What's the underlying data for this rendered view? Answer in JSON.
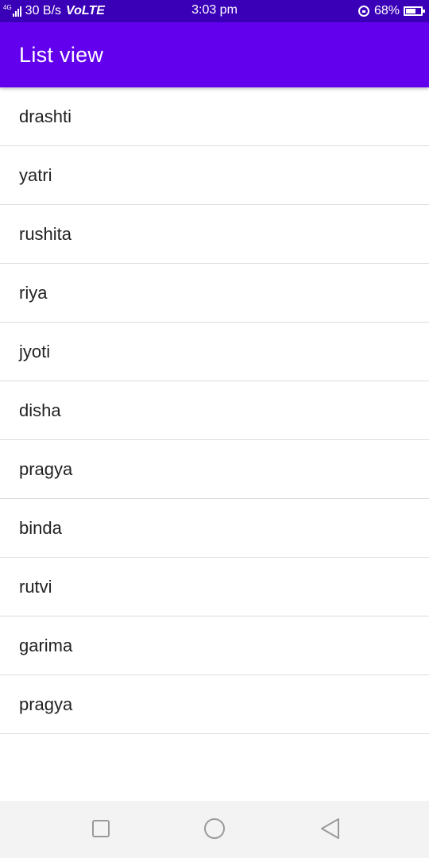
{
  "status_bar": {
    "network_type": "4G",
    "data_speed": "30 B/s",
    "volte": "VoLTE",
    "time": "3:03 pm",
    "battery_percent": "68%",
    "battery_level": 0.68,
    "icons": [
      "signal-icon",
      "rotation-lock-icon",
      "battery-icon"
    ]
  },
  "app_bar": {
    "title": "List view"
  },
  "list": {
    "items": [
      "drashti",
      "yatri",
      "rushita",
      "riya",
      "jyoti",
      "disha",
      "pragya",
      "binda",
      "rutvi",
      "garima",
      "pragya"
    ]
  },
  "nav_bar": {
    "buttons": [
      "recent-apps-icon",
      "home-icon",
      "back-icon"
    ]
  },
  "colors": {
    "status_bar": "#3a00b8",
    "app_bar": "#6200ee",
    "nav_bar": "#f3f3f3",
    "divider": "#dddddd"
  }
}
